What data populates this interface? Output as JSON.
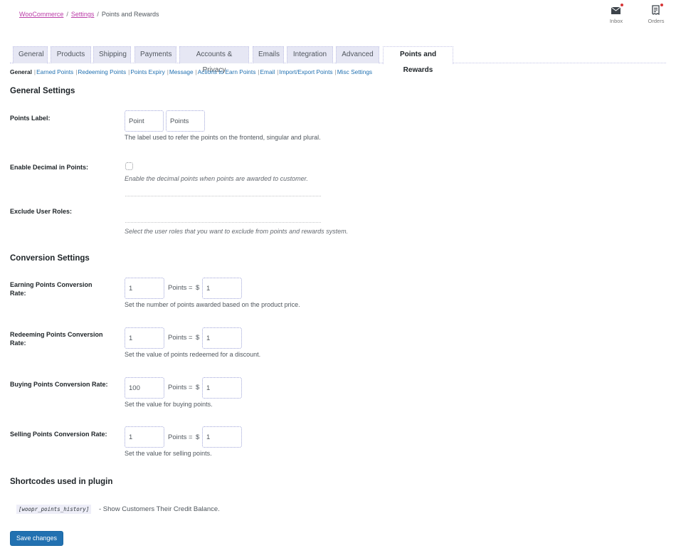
{
  "breadcrumb": {
    "items": [
      "WooCommerce",
      "Settings"
    ],
    "separator": "/",
    "current": "Points and Rewards"
  },
  "activity": {
    "inbox": {
      "label": "Inbox",
      "icon": "inbox-icon"
    },
    "orders": {
      "label": "Orders",
      "icon": "orders-icon"
    }
  },
  "tabs": [
    {
      "label": "General"
    },
    {
      "label": "Products"
    },
    {
      "label": "Shipping"
    },
    {
      "label": "Payments"
    },
    {
      "label": "Accounts & Privacy"
    },
    {
      "label": "Emails"
    },
    {
      "label": "Integration"
    },
    {
      "label": "Advanced"
    },
    {
      "label": "Points and Rewards",
      "active": true
    }
  ],
  "subnav": [
    {
      "label": "General",
      "current": true
    },
    {
      "label": "Earned Points"
    },
    {
      "label": "Redeeming Points"
    },
    {
      "label": "Points Expiry"
    },
    {
      "label": "Message"
    },
    {
      "label": "Actions to Earn Points"
    },
    {
      "label": "Email"
    },
    {
      "label": "Import/Export Points"
    },
    {
      "label": "Misc Settings"
    }
  ],
  "subnav_separator": "|",
  "general": {
    "heading": "General Settings",
    "points_label": {
      "label": "Points Label:",
      "singular": "Point",
      "plural": "Points",
      "description": "The label used to refer the points on the frontend, singular and plural."
    },
    "enable_decimal": {
      "label": "Enable Decimal in Points:",
      "checked": false,
      "description": "Enable the decimal points when points are awarded to customer."
    },
    "exclude_roles": {
      "label": "Exclude User Roles:",
      "description": "Select the user roles that you want to exclude from points and rewards system."
    }
  },
  "conversion": {
    "heading": "Conversion Settings",
    "points_text": "Points =",
    "currency": "$",
    "rows": [
      {
        "label": "Earning Points Conversion Rate:",
        "points": "1",
        "amount": "1",
        "description": "Set the number of points awarded based on the product price."
      },
      {
        "label": "Redeeming Points Conversion Rate:",
        "points": "1",
        "amount": "1",
        "description": "Set the value of points redeemed for a discount."
      },
      {
        "label": "Buying Points Conversion Rate:",
        "points": "100",
        "amount": "1",
        "description": "Set the value for buying points."
      },
      {
        "label": "Selling Points Conversion Rate:",
        "points": "1",
        "amount": "1",
        "description": "Set the value for selling points."
      }
    ]
  },
  "shortcodes": {
    "heading": "Shortcodes used in plugin",
    "items": [
      {
        "code": "[woopr_points_history]",
        "description": "- Show Customers Their Credit Balance."
      }
    ]
  },
  "save_button": "Save changes",
  "colors": {
    "link": "#2271b1",
    "breadcrumb_link": "#bb3ea8",
    "primary_button": "#2271b1",
    "notification_dot": "#d63638"
  }
}
